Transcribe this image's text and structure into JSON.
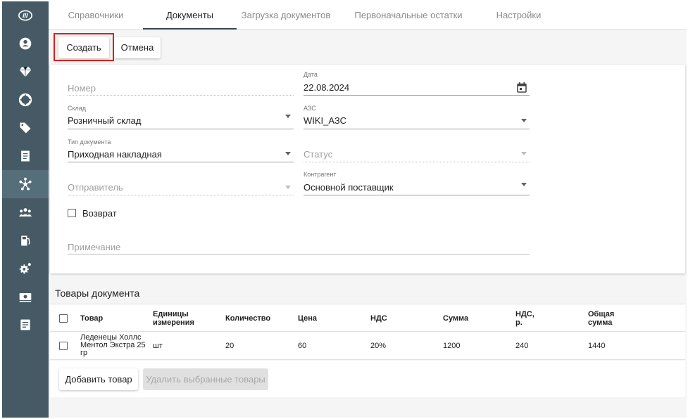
{
  "sidebar": {
    "items": [
      {
        "icon": "logo-icon"
      },
      {
        "icon": "account-icon"
      },
      {
        "icon": "diamond-icon"
      },
      {
        "icon": "lifebuoy-icon"
      },
      {
        "icon": "tag-icon"
      },
      {
        "icon": "receipt-icon"
      },
      {
        "icon": "hub-icon",
        "active": true
      },
      {
        "icon": "people-icon"
      },
      {
        "icon": "fuel-station-icon"
      },
      {
        "icon": "settings-gear-icon"
      },
      {
        "icon": "cash-icon"
      },
      {
        "icon": "list-document-icon"
      }
    ]
  },
  "tabs": [
    {
      "label": "Справочники"
    },
    {
      "label": "Документы",
      "active": true
    },
    {
      "label": "Загрузка документов"
    },
    {
      "label": "Первоначальные остатки"
    },
    {
      "label": "Настройки"
    }
  ],
  "toolbar": {
    "create_label": "Создать",
    "cancel_label": "Отмена"
  },
  "form": {
    "number": {
      "placeholder": "Номер"
    },
    "date": {
      "label": "Дата",
      "value": "22.08.2024"
    },
    "warehouse": {
      "label": "Склад",
      "value": "Розничный склад"
    },
    "station": {
      "label": "АЗС",
      "value": "WIKI_АЗС"
    },
    "doc_type": {
      "label": "Тип документа",
      "value": "Приходная накладная"
    },
    "status": {
      "placeholder": "Статус"
    },
    "sender": {
      "placeholder": "Отправитель"
    },
    "counterparty": {
      "label": "Контрагент",
      "value": "Основной поставщик"
    },
    "return_label": "Возврат",
    "note": {
      "placeholder": "Примечание"
    }
  },
  "goods": {
    "title": "Товары документа",
    "columns": {
      "product": "Товар",
      "unit_1": "Единицы",
      "unit_2": "измерения",
      "qty": "Количество",
      "price": "Цена",
      "vat": "НДС",
      "sum": "Сумма",
      "vat_r_1": "НДС,",
      "vat_r_2": "р.",
      "total_1": "Общая",
      "total_2": "сумма"
    },
    "rows": [
      {
        "name_1": "Леденецы Холлс",
        "name_2": "Ментол Экстра 25",
        "name_3": "гр",
        "unit": "шт",
        "qty": "20",
        "price": "60",
        "vat": "20%",
        "sum": "1200",
        "vat_r": "240",
        "total": "1440"
      }
    ],
    "add_label": "Добавить товар",
    "delete_label": "Удалить выбранные товары"
  }
}
